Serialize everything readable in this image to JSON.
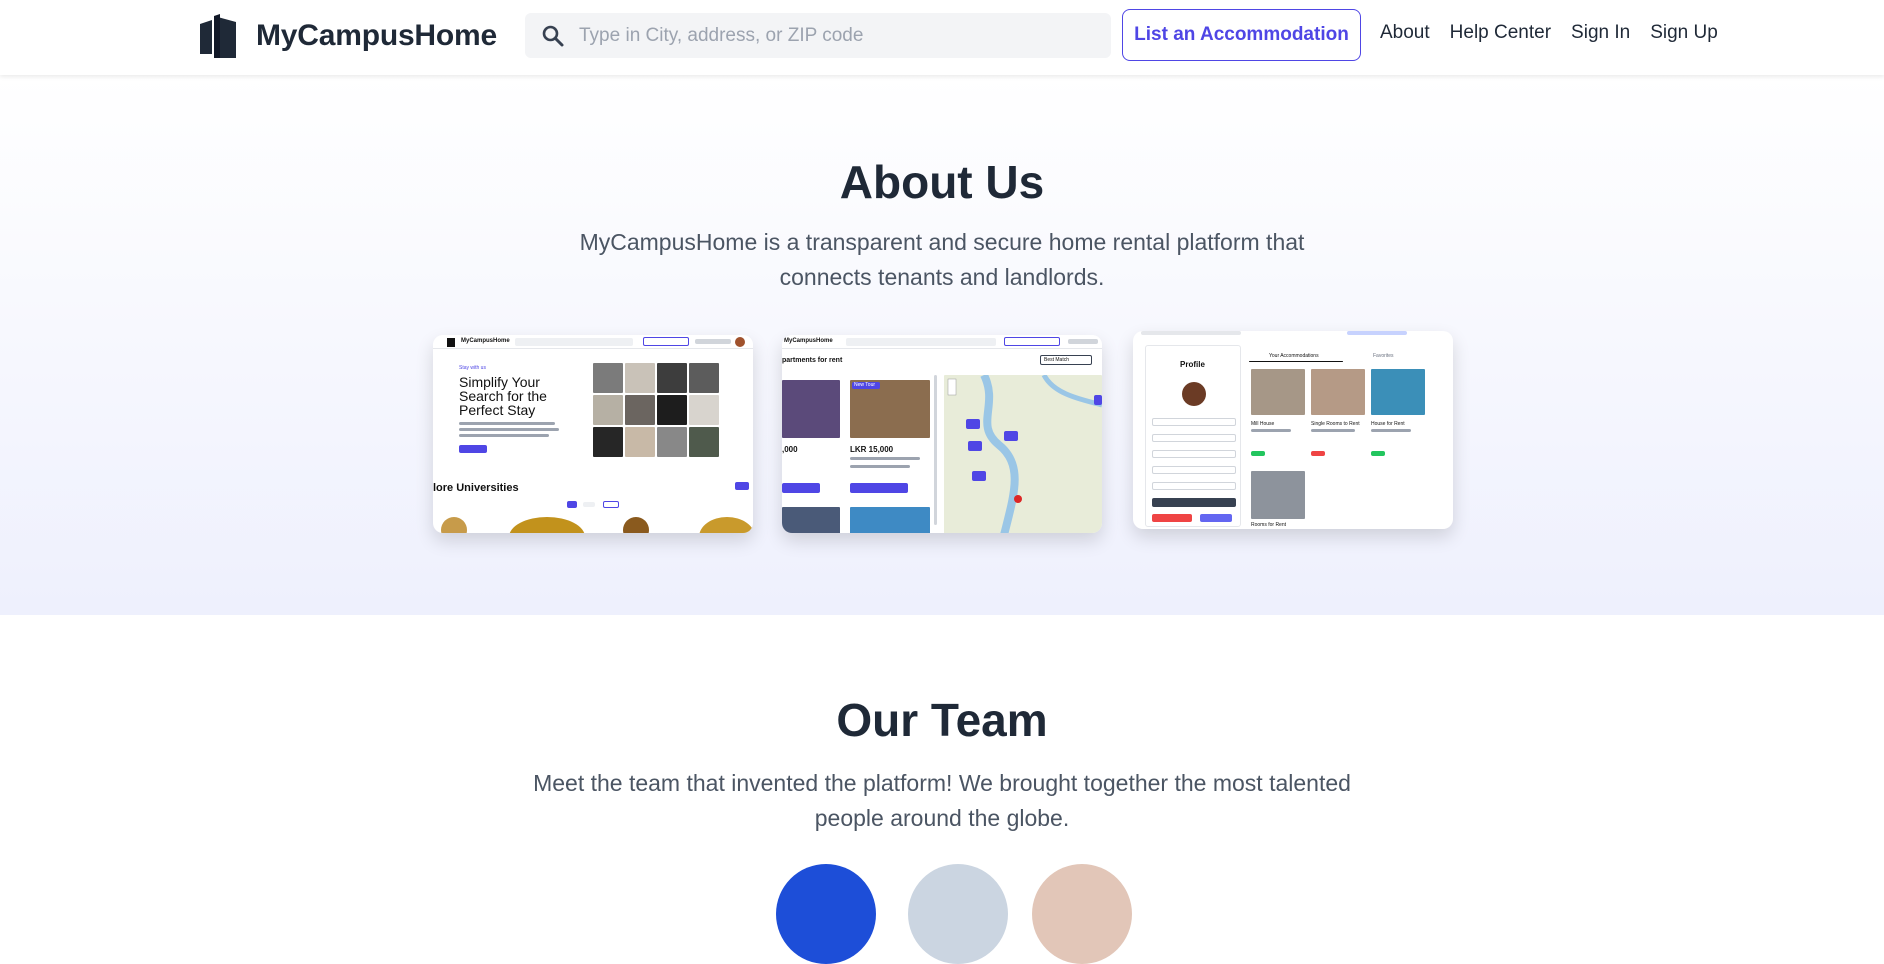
{
  "header": {
    "brand": "MyCampusHome",
    "search_placeholder": "Type in City, address, or ZIP code",
    "list_button": "List an Accommodation",
    "nav": [
      "About",
      "Help Center",
      "Sign In",
      "Sign Up"
    ]
  },
  "about": {
    "title": "About Us",
    "description": "MyCampusHome is a transparent and secure home rental platform that connects tenants and landlords.",
    "screenshots": [
      {
        "brand": "MyCampusHome",
        "hero_kicker": "Stay with us",
        "hero_title": [
          "Simplify Your",
          "Search for the",
          "Perfect Stay"
        ],
        "section_heading": "lore Universities"
      },
      {
        "brand": "MyCampusHome",
        "results_heading": "partments for rent",
        "sort_label": "Best Match",
        "prices": [
          ",000",
          "LKR 15,000"
        ],
        "badge": "New Tour"
      },
      {
        "profile_heading": "Profile",
        "tabs": [
          "Your Accommodations",
          "Favorites"
        ],
        "listings": [
          "Mill House",
          "Single Rooms to Rent",
          "House for Rent",
          "Rooms for Rent"
        ]
      }
    ]
  },
  "team": {
    "title": "Our Team",
    "description": "Meet the team that invented the platform! We brought together the most talented people around the globe."
  },
  "colors": {
    "accent": "#4f46e5",
    "text": "#1f2937",
    "muted": "#4b5563",
    "about_bg_end": "#eef0fd"
  },
  "icons": {
    "logo": "building-logo-icon",
    "search": "search-icon"
  }
}
